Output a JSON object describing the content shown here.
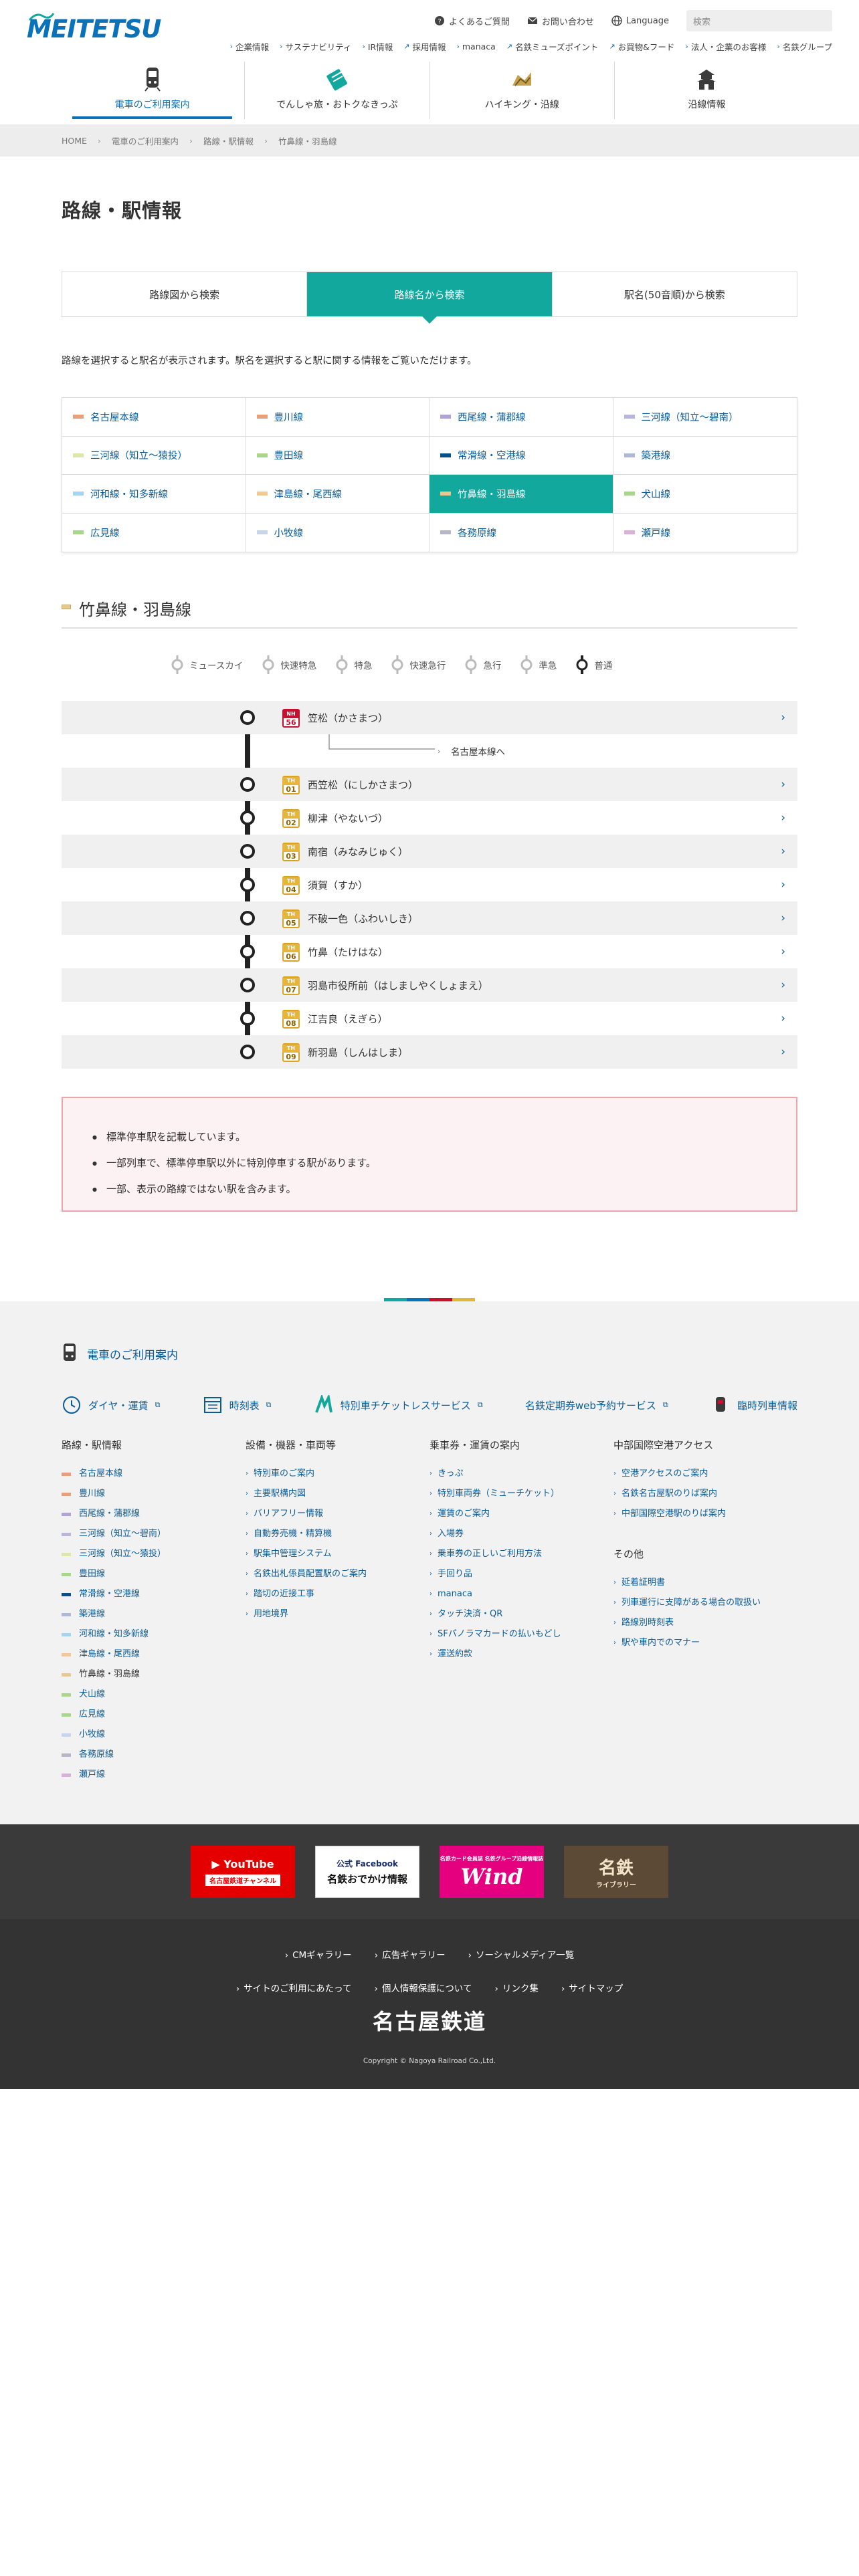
{
  "header": {
    "logo_text": "MEITETSU",
    "utility": [
      {
        "label": "よくあるご質問",
        "icon": "question-circle-icon"
      },
      {
        "label": "お問い合わせ",
        "icon": "mail-icon"
      },
      {
        "label": "Language",
        "icon": "globe-icon"
      }
    ],
    "search_placeholder": "検索",
    "corp_links": [
      "企業情報",
      "サステナビリティ",
      "IR情報",
      "採用情報",
      "manaca",
      "名鉄ミューズポイント",
      "お買物&フード",
      "法人・企業のお客様",
      "名鉄グループ"
    ],
    "gnav": [
      {
        "label": "電車のご利用案内",
        "icon": "train-icon"
      },
      {
        "label": "でんしゃ旅・おトクなきっぷ",
        "icon": "ticket-icon"
      },
      {
        "label": "ハイキング・沿線",
        "icon": "hiking-icon"
      },
      {
        "label": "沿線情報",
        "icon": "castle-icon"
      }
    ]
  },
  "breadcrumb": [
    "HOME",
    "電車のご利用案内",
    "路線・駅情報",
    "竹鼻線・羽島線"
  ],
  "page_title": "路線・駅情報",
  "tabs": [
    "路線図から検索",
    "路線名から検索",
    "駅名(50音順)から検索"
  ],
  "lead": "路線を選択すると駅名が表示されます。駅名を選択すると駅に関する情報をご覧いただけます。",
  "lines": [
    {
      "label": "名古屋本線",
      "color": "#e8a07a"
    },
    {
      "label": "豊川線",
      "color": "#e8a07a"
    },
    {
      "label": "西尾線・蒲郡線",
      "color": "#b0a3d6"
    },
    {
      "label": "三河線（知立〜碧南）",
      "color": "#b7b7dd"
    },
    {
      "label": "三河線（知立〜猿投）",
      "color": "#dde7a8"
    },
    {
      "label": "豊田線",
      "color": "#a8d68a"
    },
    {
      "label": "常滑線・空港線",
      "color": "#0b4f8a"
    },
    {
      "label": "築港線",
      "color": "#b0b8d8"
    },
    {
      "label": "河和線・知多新線",
      "color": "#a3d4f2"
    },
    {
      "label": "津島線・尾西線",
      "color": "#f2c89a"
    },
    {
      "label": "竹鼻線・羽島線",
      "color": "#e7c98f"
    },
    {
      "label": "犬山線",
      "color": "#a8d68a"
    },
    {
      "label": "広見線",
      "color": "#a8d68a"
    },
    {
      "label": "小牧線",
      "color": "#c8d4ea"
    },
    {
      "label": "各務原線",
      "color": "#b6b6c8"
    },
    {
      "label": "瀬戸線",
      "color": "#d8b0d8"
    }
  ],
  "section_title": "竹鼻線・羽島線",
  "legend": [
    "ミュースカイ",
    "快速特急",
    "特急",
    "快速急行",
    "急行",
    "準急",
    "普通"
  ],
  "stations": [
    {
      "code_line": "NH",
      "code_no": "56",
      "name": "笠松（かさまつ）"
    },
    {
      "code_line": "TH",
      "code_no": "01",
      "name": "西笠松（にしかさまつ）"
    },
    {
      "code_line": "TH",
      "code_no": "02",
      "name": "柳津（やないづ）"
    },
    {
      "code_line": "TH",
      "code_no": "03",
      "name": "南宿（みなみじゅく）"
    },
    {
      "code_line": "TH",
      "code_no": "04",
      "name": "須賀（すか）"
    },
    {
      "code_line": "TH",
      "code_no": "05",
      "name": "不破一色（ふわいしき）"
    },
    {
      "code_line": "TH",
      "code_no": "06",
      "name": "竹鼻（たけはな）"
    },
    {
      "code_line": "TH",
      "code_no": "07",
      "name": "羽島市役所前（はしましやくしょまえ）"
    },
    {
      "code_line": "TH",
      "code_no": "08",
      "name": "江吉良（えぎら）"
    },
    {
      "code_line": "TH",
      "code_no": "09",
      "name": "新羽島（しんはしま）"
    }
  ],
  "transfer_link": "名古屋本線へ",
  "notes": [
    "標準停車駅を記載しています。",
    "一部列車で、標準停車駅以外に特別停車する駅があります。",
    "一部、表示の路線ではない駅を含みます。"
  ],
  "footer": {
    "heading": "電車のご利用案内",
    "services": [
      "ダイヤ・運賃",
      "時刻表",
      "特別車チケットレスサービス",
      "名鉄定期券web予約サービス",
      "臨時列車情報"
    ],
    "col1_title": "路線・駅情報",
    "col1": [
      "名古屋本線",
      "豊川線",
      "西尾線・蒲郡線",
      "三河線（知立〜碧南）",
      "三河線（知立〜猿投）",
      "豊田線",
      "常滑線・空港線",
      "築港線",
      "河和線・知多新線",
      "津島線・尾西線",
      "竹鼻線・羽島線",
      "犬山線",
      "広見線",
      "小牧線",
      "各務原線",
      "瀬戸線"
    ],
    "col2_title": "設備・機器・車両等",
    "col2": [
      "特別車のご案内",
      "主要駅構内図",
      "バリアフリー情報",
      "自動券売機・精算機",
      "駅集中管理システム",
      "名鉄出札係員配置駅のご案内",
      "踏切の近接工事",
      "用地境界"
    ],
    "col3_title": "乗車券・運賃の案内",
    "col3": [
      "きっぷ",
      "特別車両券（ミューチケット）",
      "運賃のご案内",
      "入場券",
      "乗車券の正しいご利用方法",
      "手回り品",
      "manaca",
      "タッチ決済・QR",
      "SFパノラマカードの払いもどし",
      "運送約款"
    ],
    "col4_title": "中部国際空港アクセス",
    "col4": [
      "空港アクセスのご案内",
      "名鉄名古屋駅のりば案内",
      "中部国際空港駅のりば案内"
    ],
    "col4b_title": "その他",
    "col4b": [
      "延着証明書",
      "列車運行に支障がある場合の取扱い",
      "路線別時刻表",
      "駅や車内でのマナー"
    ]
  },
  "banners": {
    "youtube": "YouTube",
    "youtube_sub": "名古屋鉄道チャンネル",
    "facebook_top": "公式 Facebook",
    "facebook_main": "名鉄おでかけ情報",
    "wind_small": "名鉄カード会員誌 名鉄グループ沿線情報誌",
    "wind": "Wind",
    "library": "名鉄",
    "library_sub": "ライブラリー"
  },
  "bottom": {
    "row1": [
      "CMギャラリー",
      "広告ギャラリー",
      "ソーシャルメディア一覧"
    ],
    "row2": [
      "サイトのご利用にあたって",
      "個人情報保護について",
      "リンク集",
      "サイトマップ"
    ],
    "brand": "名古屋鉄道",
    "copyright": "Copyright © Nagoya Railroad Co.,Ltd."
  },
  "colors": {
    "accent": "#13a89e",
    "brand": "#0a72b8",
    "link": "#0a5c99",
    "badge_nh": "#c8102e",
    "badge_th": "#d9a520"
  }
}
